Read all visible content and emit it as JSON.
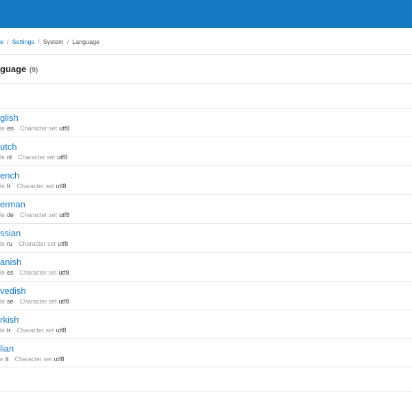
{
  "breadcrumb": {
    "home": "e",
    "settings": "Settings",
    "system": "System",
    "current": "Language",
    "separator": "/"
  },
  "page": {
    "title": "guage",
    "count": "(9)"
  },
  "languages": [
    {
      "name": "glish",
      "code_label": "le",
      "code": "en",
      "charset_label": "Character set",
      "charset": "utf8"
    },
    {
      "name": "utch",
      "code_label": "le",
      "code": "nl",
      "charset_label": "Character set",
      "charset": "utf8"
    },
    {
      "name": "ench",
      "code_label": "le",
      "code": "fr",
      "charset_label": "Character set",
      "charset": "utf8"
    },
    {
      "name": "erman",
      "code_label": "le",
      "code": "de",
      "charset_label": "Character set",
      "charset": "utf8"
    },
    {
      "name": "ssian",
      "code_label": "le",
      "code": "ru",
      "charset_label": "Character set",
      "charset": "utf8"
    },
    {
      "name": "anish",
      "code_label": "le",
      "code": "es",
      "charset_label": "Character set",
      "charset": "utf8"
    },
    {
      "name": "vedish",
      "code_label": "le",
      "code": "se",
      "charset_label": "Character set",
      "charset": "utf8"
    },
    {
      "name": "rkish",
      "code_label": "le",
      "code": "tr",
      "charset_label": "Character set",
      "charset": "utf8"
    },
    {
      "name": "lian",
      "code_label": "e",
      "code": "it",
      "charset_label": "Character set",
      "charset": "utf8"
    }
  ],
  "colors": {
    "topbar": "#1778c2",
    "link": "#1778c2"
  }
}
